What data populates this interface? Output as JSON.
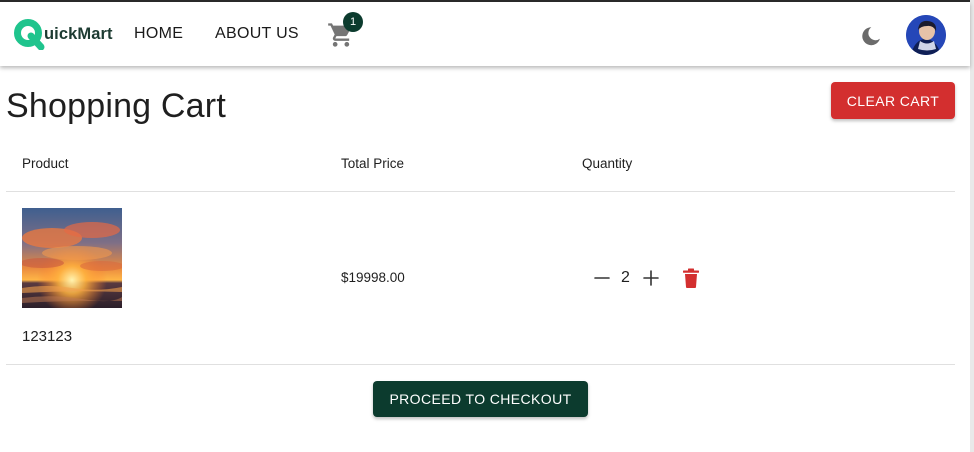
{
  "brand": {
    "logo_text": "uickMart",
    "accent_color": "#1fc48d"
  },
  "nav": {
    "home": "HOME",
    "about": "ABOUT US"
  },
  "cart": {
    "count": "1",
    "icon": "cart-icon"
  },
  "header_icons": {
    "theme": "moon-icon",
    "avatar": "user-avatar"
  },
  "page": {
    "title": "Shopping Cart",
    "clear_label": "CLEAR CART"
  },
  "table": {
    "headers": [
      "Product",
      "Total Price",
      "Quantity"
    ],
    "rows": [
      {
        "name": "123123",
        "total_price": "$19998.00",
        "quantity": "2",
        "image": "sunset-photo"
      }
    ]
  },
  "checkout": {
    "label": "PROCEED TO CHECKOUT"
  },
  "colors": {
    "primary": "#0c3b2e",
    "danger": "#d32f2f"
  }
}
